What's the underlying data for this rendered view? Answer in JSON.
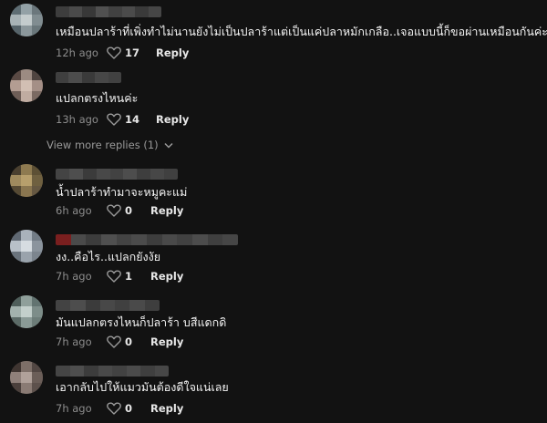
{
  "comments": [
    {
      "text": "เหมือนปลาร้าที่เพิ่งทำไม่นานยังไม่เป็นปลาร้าแต่เป็นแค่ปลาหมักเกลือ..เจอแบบนี้ก็ขอผ่านเหมือนกันค่ะ",
      "has_emoji": true,
      "time": "12h ago",
      "likes": "17",
      "reply": "Reply"
    },
    {
      "text": "แปลกตรงไหนค่ะ",
      "time": "13h ago",
      "likes": "14",
      "reply": "Reply"
    },
    {
      "text": "น้ำปลาร้าทำมาจะหมูคะแม่",
      "time": "6h ago",
      "likes": "0",
      "reply": "Reply"
    },
    {
      "text": "งง..คือไร..แปลกยังงัย",
      "time": "7h ago",
      "likes": "1",
      "reply": "Reply"
    },
    {
      "text": "มันแปลกตรงไหนก็ปลาร้า บสีแดกดิ",
      "time": "7h ago",
      "likes": "0",
      "reply": "Reply"
    },
    {
      "text": "เอากลับไปให้แมวมันต้องดีใจแน่เลย",
      "time": "7h ago",
      "likes": "0",
      "reply": "Reply"
    }
  ],
  "view_more": {
    "label": "View more replies (1)"
  },
  "icons": {
    "like": "heart-outline-icon",
    "expand": "chevron-down-icon",
    "emoji": "grinning-sweat-emoji"
  },
  "colors": {
    "background": "#121212",
    "text": "#f3f3f3",
    "muted": "#8d8d8d"
  }
}
